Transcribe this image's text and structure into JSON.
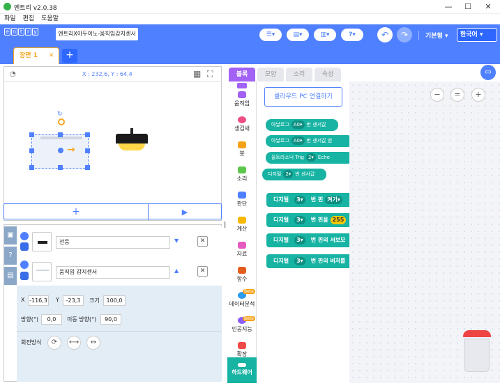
{
  "app": {
    "title": "엔트리 v2.0.38",
    "menu": [
      "파일",
      "편집",
      "도움말"
    ],
    "min_glyph": "—",
    "max_glyph": "☐",
    "close_glyph": "✕"
  },
  "header": {
    "logo_letters": [
      "e",
      "n",
      "t",
      "r",
      "y"
    ],
    "project_name": "엔트리X아두이노-움직임감지센서",
    "mode": "기본형",
    "language": "한국어",
    "help_glyph": "?"
  },
  "scene": {
    "tab_label": "장면 1",
    "close_glyph": "✕",
    "add_glyph": "+"
  },
  "stage": {
    "coords": "X : 232,6, Y : 64,4",
    "add_glyph": "+",
    "play_glyph": "▶"
  },
  "objects": [
    {
      "name": "전등",
      "arrow": "▼",
      "close": "✕"
    },
    {
      "name": "움직임 감지센서",
      "arrow": "▲",
      "close": "✕"
    }
  ],
  "props": {
    "x_label": "X",
    "x": "-116,3",
    "y_label": "Y",
    "y": "-23,3",
    "size_label": "크기",
    "size": "100,0",
    "dir_label": "방향(°)",
    "dir": "0,0",
    "move_dir_label": "이동 방향(°)",
    "move_dir": "90,0",
    "rot_label": "회전방식",
    "rot_icons": [
      "⟳",
      "⟷",
      "↔"
    ]
  },
  "sidetabs": [
    "▣",
    "?",
    "▤"
  ],
  "tabs": [
    "블록",
    "모양",
    "소리",
    "속성"
  ],
  "categories": [
    {
      "label": "움직임",
      "color": "#a262f5"
    },
    {
      "label": "생김새",
      "color": "#ef4d87"
    },
    {
      "label": "붓",
      "color": "#f7a119"
    },
    {
      "label": "소리",
      "color": "#5cc84b"
    },
    {
      "label": "판단",
      "color": "#4f80ff"
    },
    {
      "label": "계산",
      "color": "#f8b800"
    },
    {
      "label": "자료",
      "color": "#e55ac0"
    },
    {
      "label": "함수",
      "color": "#e25d1c"
    },
    {
      "label": "데이터분석",
      "color": "#2d9bf0"
    },
    {
      "label": "인공지능",
      "color": "#8a5cf5"
    },
    {
      "label": "확장",
      "color": "#ef4a4a"
    },
    {
      "label": "하드웨어",
      "color": "#17b3a3"
    }
  ],
  "beta": "Beta",
  "palette": {
    "connect_label": "클라우드 PC 연결하기",
    "small_blocks": [
      {
        "a": "아날로그",
        "b": "A0▾",
        "c": "번 센서값"
      },
      {
        "a": "아날로그",
        "b": "A0▾",
        "c": "번 센서값 범"
      },
      {
        "a": "울트라소닉 Trig",
        "b": "2▾",
        "c": "Echo"
      },
      {
        "a": "디지털",
        "b": "2▾",
        "c": "번 센서값"
      }
    ],
    "big_blocks": [
      {
        "a": "디지털",
        "b": "3▾",
        "c": "번 핀",
        "d": "켜기▾"
      },
      {
        "a": "디지털",
        "b": "3▾",
        "c": "번 핀을",
        "d": "255"
      },
      {
        "a": "디지털",
        "b": "3▾",
        "c": "번 핀의 서보모",
        "d": ""
      },
      {
        "a": "디지털",
        "b": "3▾",
        "c": "번 핀의 버저를",
        "d": ""
      }
    ]
  },
  "zoom": {
    "out": "−",
    "reset": "=",
    "in": "+"
  },
  "colors": {
    "accent": "#4f80ff",
    "scene": "#f6a623",
    "hardware": "#17b3a3"
  }
}
